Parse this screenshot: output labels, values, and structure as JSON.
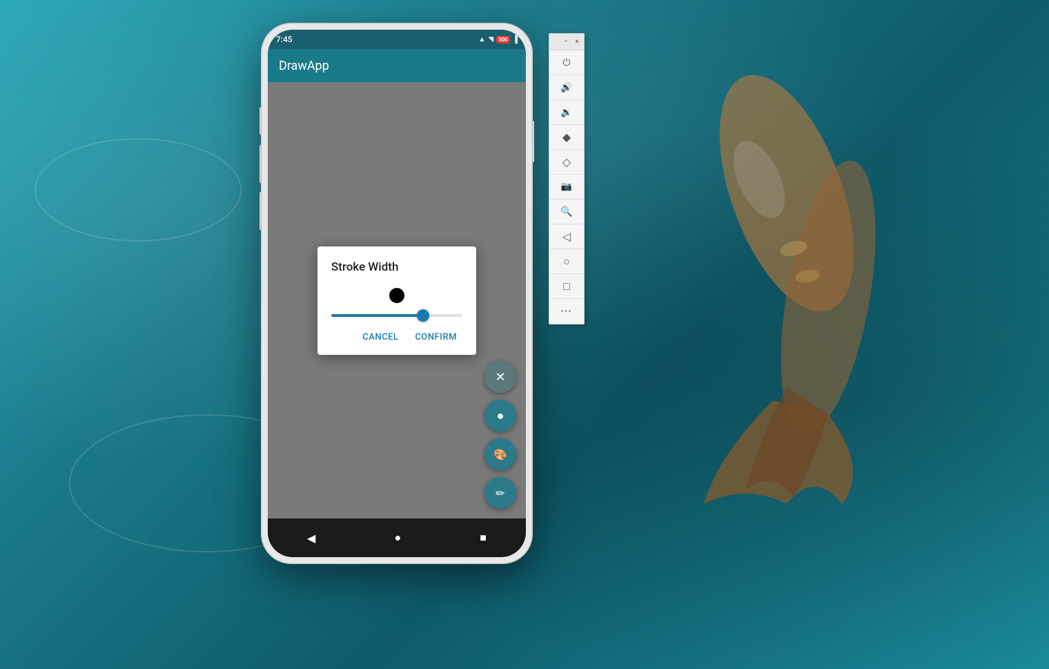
{
  "background": {
    "color_start": "#2aa8b8",
    "color_end": "#0e5a6a"
  },
  "phone": {
    "status_bar": {
      "time": "7:45",
      "icons": [
        "wifi",
        "signal",
        "battery"
      ],
      "badge_text": "500"
    },
    "app_bar": {
      "title": "DrawApp"
    },
    "dialog": {
      "title": "Stroke Width",
      "slider_value": 72,
      "cancel_label": "Cancel",
      "confirm_label": "Confirm"
    },
    "fab_buttons": [
      {
        "icon": "✕",
        "name": "close-fab"
      },
      {
        "icon": "●",
        "name": "stroke-fab"
      },
      {
        "icon": "🎨",
        "name": "color-fab"
      },
      {
        "icon": "✏",
        "name": "pen-fab"
      }
    ],
    "nav_bar": {
      "back_icon": "◀",
      "home_icon": "●",
      "recents_icon": "■"
    }
  },
  "side_toolbar": {
    "title": "",
    "minimize_label": "−",
    "close_label": "×",
    "items": [
      {
        "icon": "⏻",
        "name": "power"
      },
      {
        "icon": "🔊",
        "name": "volume-up"
      },
      {
        "icon": "🔈",
        "name": "volume-down"
      },
      {
        "icon": "◆",
        "name": "eraser"
      },
      {
        "icon": "◇",
        "name": "shape-eraser"
      },
      {
        "icon": "📷",
        "name": "screenshot"
      },
      {
        "icon": "🔍",
        "name": "zoom"
      },
      {
        "icon": "◁",
        "name": "back"
      },
      {
        "icon": "○",
        "name": "circle"
      },
      {
        "icon": "□",
        "name": "rectangle"
      },
      {
        "icon": "•••",
        "name": "more"
      }
    ]
  }
}
